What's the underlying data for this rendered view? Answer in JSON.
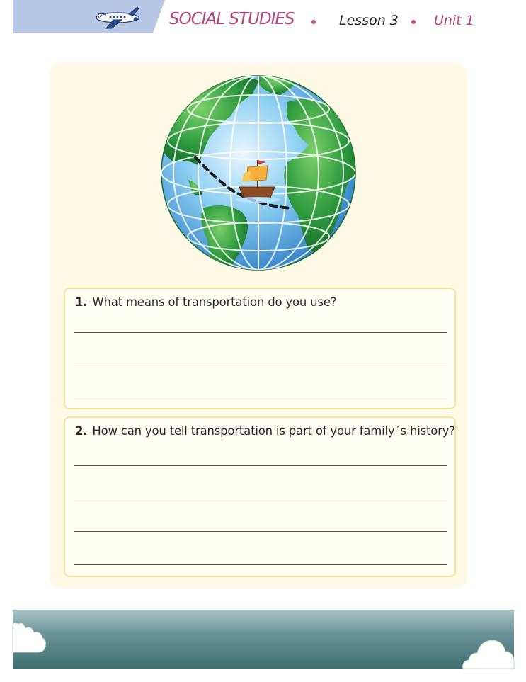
{
  "header": {
    "subject": "SOCIAL STUDIES",
    "lesson": "Lesson 3",
    "unit": "Unit 1"
  },
  "questions": [
    {
      "number": "1.",
      "text": "What means of transportation do you use?",
      "answer_lines": 3
    },
    {
      "number": "2.",
      "text": "How can you tell transportation is part of your family´s history?",
      "answer_lines": 4
    }
  ],
  "icons": {
    "header": "airplane-icon",
    "illustration": "globe-with-ship",
    "decor": "cloud-icon"
  },
  "colors": {
    "header_tab": "#b7c7e6",
    "accent": "#b2457a",
    "card_bg": "#fffae5",
    "box_border": "#f5e39b",
    "ocean": "#6fb3e6",
    "land": "#2e9b3e"
  }
}
